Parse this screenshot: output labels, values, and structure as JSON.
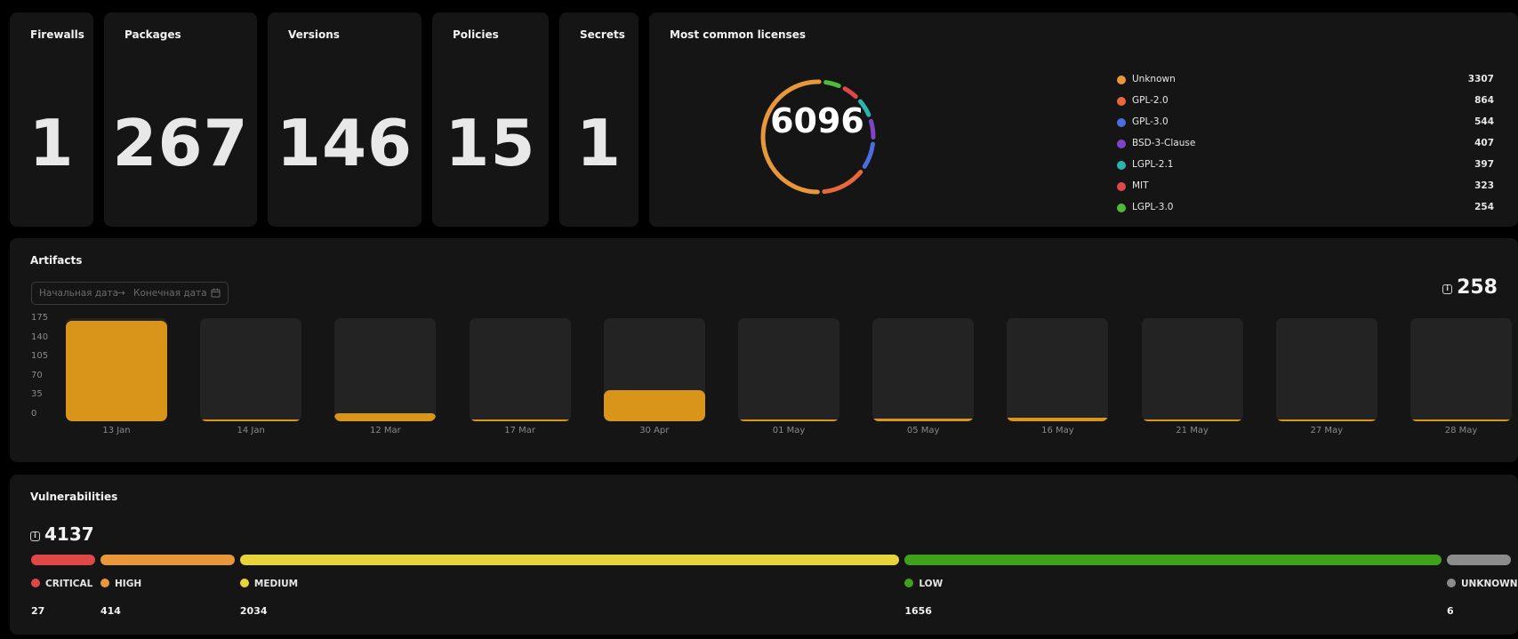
{
  "stats": {
    "firewalls": {
      "label": "Firewalls",
      "value": "1"
    },
    "packages": {
      "label": "Packages",
      "value": "267"
    },
    "versions": {
      "label": "Versions",
      "value": "146"
    },
    "policies": {
      "label": "Policies",
      "value": "15"
    },
    "secrets": {
      "label": "Secrets",
      "value": "1"
    }
  },
  "licenses": {
    "title": "Most common licenses",
    "total": "6096",
    "items": [
      {
        "label": "Unknown",
        "value": "3307",
        "color": "#e8983a"
      },
      {
        "label": "GPL-2.0",
        "value": "864",
        "color": "#e8683a"
      },
      {
        "label": "GPL-3.0",
        "value": "544",
        "color": "#4a6ee0"
      },
      {
        "label": "BSD-3-Clause",
        "value": "407",
        "color": "#8044c8"
      },
      {
        "label": "LGPL-2.1",
        "value": "397",
        "color": "#2bb3b0"
      },
      {
        "label": "MIT",
        "value": "323",
        "color": "#e04848"
      },
      {
        "label": "LGPL-3.0",
        "value": "254",
        "color": "#52b83a"
      }
    ]
  },
  "artifacts": {
    "title": "Artifacts",
    "date_start_placeholder": "Начальная дата",
    "date_arrow": "→",
    "date_end_placeholder": "Конечная дата",
    "total": "258",
    "bar_color": "#d9951a",
    "chart_data": {
      "type": "bar",
      "categories": [
        "13 Jan",
        "14 Jan",
        "12 Mar",
        "17 Mar",
        "30 Apr",
        "01 May",
        "05 May",
        "16 May",
        "21 May",
        "27 May",
        "28 May"
      ],
      "values": [
        170,
        1,
        13,
        1,
        53,
        2,
        4,
        6,
        1,
        2,
        1
      ],
      "ylim": [
        0,
        175
      ],
      "y_ticks": [
        "175",
        "140",
        "105",
        "70",
        "35",
        "0"
      ]
    }
  },
  "vulnerabilities": {
    "title": "Vulnerabilities",
    "total": "4137",
    "levels": [
      {
        "label": "CRITICAL",
        "count": "27",
        "color": "#e04848"
      },
      {
        "label": "HIGH",
        "count": "414",
        "color": "#e8983a"
      },
      {
        "label": "MEDIUM",
        "count": "2034",
        "color": "#e6d43a"
      },
      {
        "label": "LOW",
        "count": "1656",
        "color": "#3fa01a"
      },
      {
        "label": "UNKNOWN",
        "count": "6",
        "color": "#8c8c8c"
      }
    ]
  }
}
